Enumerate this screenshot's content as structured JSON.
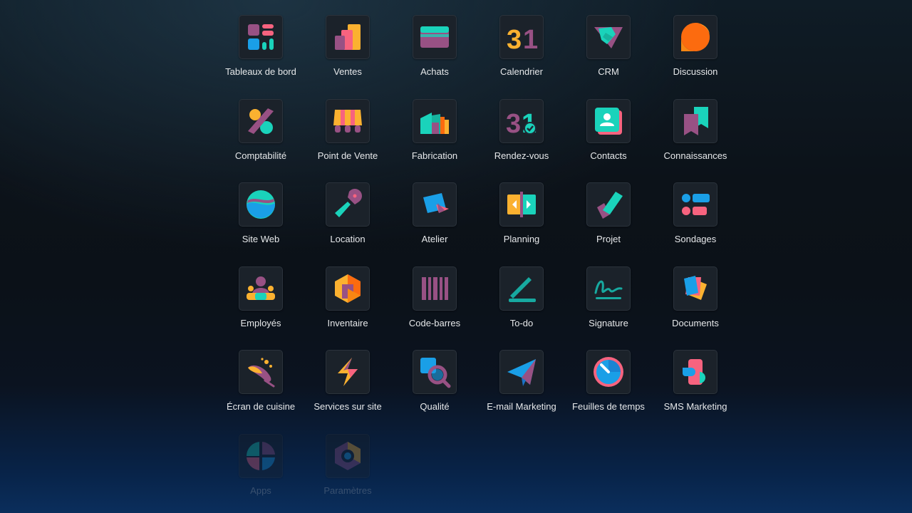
{
  "apps": [
    {
      "label": "Tableaux de bord",
      "icon": "dashboards-icon"
    },
    {
      "label": "Ventes",
      "icon": "sales-icon"
    },
    {
      "label": "Achats",
      "icon": "purchase-icon"
    },
    {
      "label": "Calendrier",
      "icon": "calendar-icon"
    },
    {
      "label": "CRM",
      "icon": "crm-icon"
    },
    {
      "label": "Discussion",
      "icon": "discuss-icon"
    },
    {
      "label": "Comptabilité",
      "icon": "accounting-icon"
    },
    {
      "label": "Point de Vente",
      "icon": "point-of-sale-icon"
    },
    {
      "label": "Fabrication",
      "icon": "manufacturing-icon"
    },
    {
      "label": "Rendez-vous",
      "icon": "appointments-icon"
    },
    {
      "label": "Contacts",
      "icon": "contacts-icon"
    },
    {
      "label": "Connaissances",
      "icon": "knowledge-icon"
    },
    {
      "label": "Site Web",
      "icon": "website-icon"
    },
    {
      "label": "Location",
      "icon": "rental-icon"
    },
    {
      "label": "Atelier",
      "icon": "workshop-icon"
    },
    {
      "label": "Planning",
      "icon": "planning-icon"
    },
    {
      "label": "Projet",
      "icon": "project-icon"
    },
    {
      "label": "Sondages",
      "icon": "surveys-icon"
    },
    {
      "label": "Employés",
      "icon": "employees-icon"
    },
    {
      "label": "Inventaire",
      "icon": "inventory-icon"
    },
    {
      "label": "Code-barres",
      "icon": "barcode-icon"
    },
    {
      "label": "To-do",
      "icon": "todo-icon"
    },
    {
      "label": "Signature",
      "icon": "signature-icon"
    },
    {
      "label": "Documents",
      "icon": "documents-icon"
    },
    {
      "label": "Écran de cuisine",
      "icon": "kitchen-display-icon"
    },
    {
      "label": "Services sur site",
      "icon": "field-service-icon"
    },
    {
      "label": "Qualité",
      "icon": "quality-icon"
    },
    {
      "label": "E-mail Marketing",
      "icon": "email-marketing-icon"
    },
    {
      "label": "Feuilles de temps",
      "icon": "timesheets-icon"
    },
    {
      "label": "SMS Marketing",
      "icon": "sms-marketing-icon"
    },
    {
      "label": "Apps",
      "icon": "apps-icon"
    },
    {
      "label": "Paramètres",
      "icon": "settings-icon"
    }
  ],
  "colors": {
    "teal": "#1ad3bb",
    "purple": "#985184",
    "orange": "#fc6b0f",
    "yellow": "#fbb130",
    "pink": "#f7637f",
    "blue": "#1a9fe7"
  }
}
